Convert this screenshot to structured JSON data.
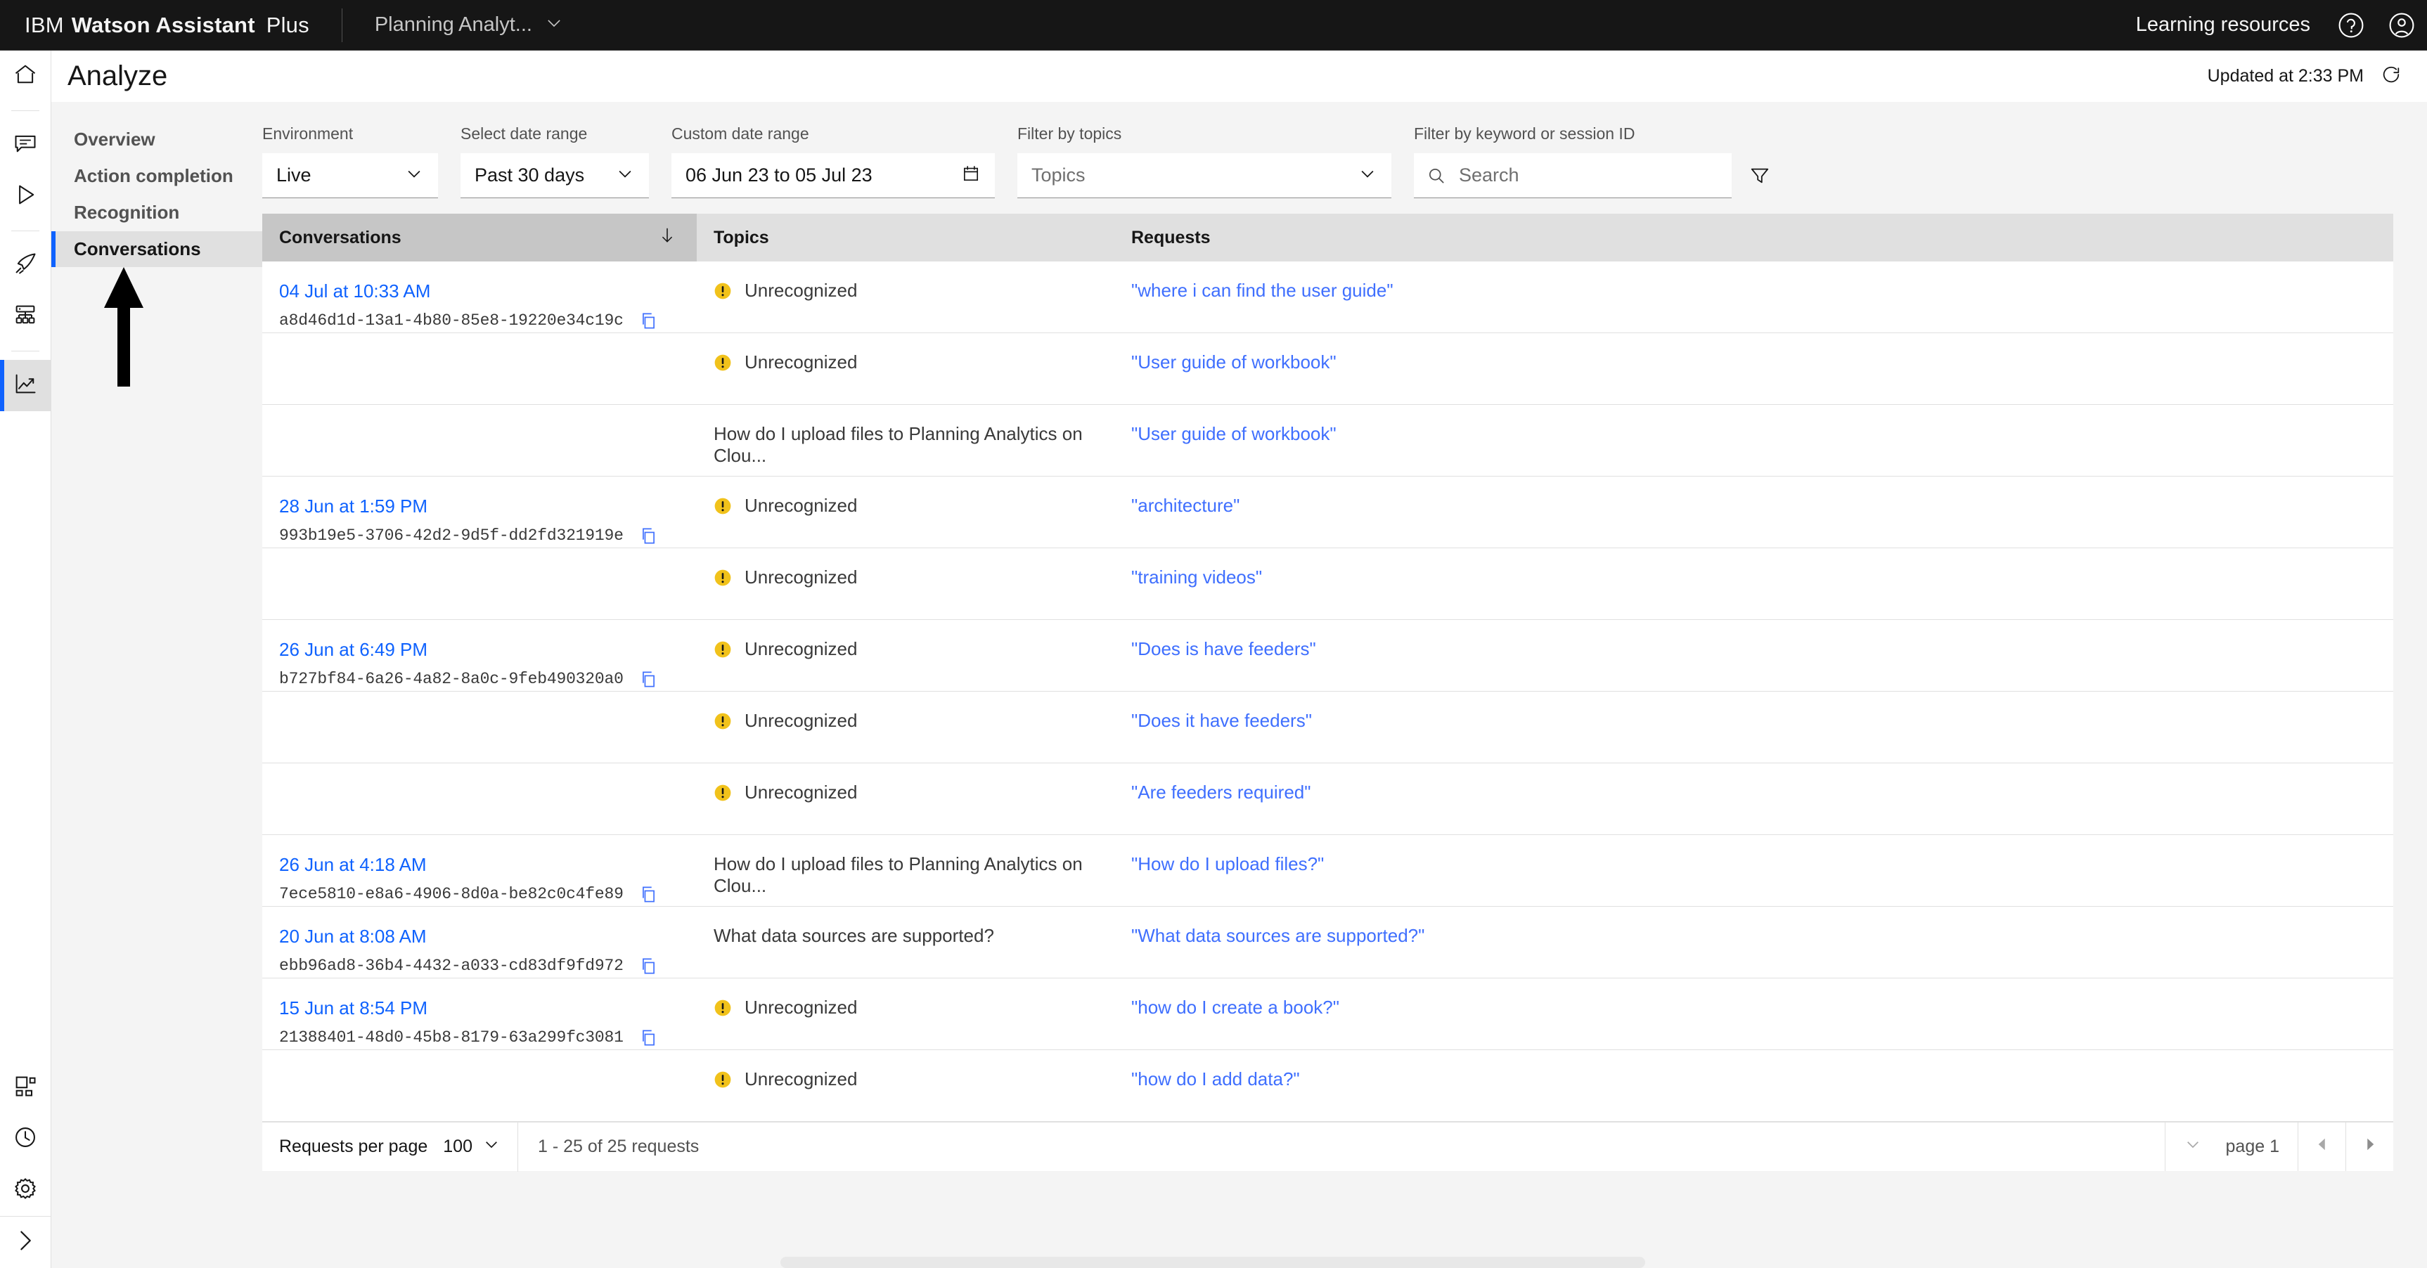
{
  "header": {
    "brand_ibm": "IBM",
    "brand_product": "Watson Assistant",
    "brand_plan": "Plus",
    "assistant_name": "Planning Analyt...",
    "learning_resources": "Learning resources",
    "help_icon": "help-icon",
    "account_icon": "user-avatar-icon",
    "chevron_icon": "chevron-down-icon"
  },
  "rail": {
    "items": [
      {
        "name": "home-icon"
      },
      {
        "name": "chat-icon"
      },
      {
        "name": "preview-play-icon"
      },
      {
        "name": "publish-rocket-icon"
      },
      {
        "name": "integrations-icon"
      },
      {
        "name": "analyze-chart-icon"
      },
      {
        "name": "assistants-icon"
      },
      {
        "name": "activity-clock-icon"
      },
      {
        "name": "settings-gear-icon"
      },
      {
        "name": "expand-rail-icon"
      }
    ]
  },
  "page": {
    "title": "Analyze",
    "updated_text": "Updated at 2:33 PM",
    "refresh_icon": "refresh-icon"
  },
  "leftnav": {
    "items": [
      {
        "label": "Overview",
        "active": false
      },
      {
        "label": "Action completion",
        "active": false
      },
      {
        "label": "Recognition",
        "active": false
      },
      {
        "label": "Conversations",
        "active": true
      }
    ]
  },
  "filters": {
    "environment": {
      "label": "Environment",
      "value": "Live"
    },
    "date_range": {
      "label": "Select date range",
      "value": "Past 30 days"
    },
    "custom_range": {
      "label": "Custom date range",
      "value": "06 Jun 23 to 05 Jul 23",
      "icon": "calendar-icon"
    },
    "topics": {
      "label": "Filter by topics",
      "placeholder": "Topics"
    },
    "keyword": {
      "label": "Filter by keyword or session ID",
      "placeholder": "Search",
      "value": "",
      "icon": "search-icon"
    },
    "filter_button_icon": "filter-funnel-icon"
  },
  "table": {
    "columns": [
      {
        "label": "Conversations",
        "sorted": true,
        "sort_icon": "sort-arrow-down-icon"
      },
      {
        "label": "Topics",
        "sorted": false
      },
      {
        "label": "Requests",
        "sorted": false
      }
    ],
    "rows": [
      {
        "date": "04 Jul at 10:33 AM",
        "session_id": "a8d46d1d-13a1-4b80-85e8-19220e34c19c",
        "topic": "Unrecognized",
        "topic_unrecognized": true,
        "request": "\"where i can find the user guide\""
      },
      {
        "date": "",
        "session_id": "",
        "topic": "Unrecognized",
        "topic_unrecognized": true,
        "request": "\"User guide of workbook\""
      },
      {
        "date": "",
        "session_id": "",
        "topic": "How do I upload files to Planning Analytics on Clou...",
        "topic_unrecognized": false,
        "request": "\"User guide of workbook\""
      },
      {
        "date": "28 Jun at 1:59 PM",
        "session_id": "993b19e5-3706-42d2-9d5f-dd2fd321919e",
        "topic": "Unrecognized",
        "topic_unrecognized": true,
        "request": "\"architecture\""
      },
      {
        "date": "",
        "session_id": "",
        "topic": "Unrecognized",
        "topic_unrecognized": true,
        "request": "\"training videos\""
      },
      {
        "date": "26 Jun at 6:49 PM",
        "session_id": "b727bf84-6a26-4a82-8a0c-9feb490320a0",
        "topic": "Unrecognized",
        "topic_unrecognized": true,
        "request": "\"Does is have feeders\""
      },
      {
        "date": "",
        "session_id": "",
        "topic": "Unrecognized",
        "topic_unrecognized": true,
        "request": "\"Does it have feeders\""
      },
      {
        "date": "",
        "session_id": "",
        "topic": "Unrecognized",
        "topic_unrecognized": true,
        "request": "\"Are feeders required\""
      },
      {
        "date": "26 Jun at 4:18 AM",
        "session_id": "7ece5810-e8a6-4906-8d0a-be82c0c4fe89",
        "topic": "How do I upload files to Planning Analytics on Clou...",
        "topic_unrecognized": false,
        "request": "\"How do I upload files?\""
      },
      {
        "date": "20 Jun at 8:08 AM",
        "session_id": "ebb96ad8-36b4-4432-a033-cd83df9fd972",
        "topic": "What data sources are supported?",
        "topic_unrecognized": false,
        "request": "\"What data sources are supported?\""
      },
      {
        "date": "15 Jun at 8:54 PM",
        "session_id": "21388401-48d0-45b8-8179-63a299fc3081",
        "topic": "Unrecognized",
        "topic_unrecognized": true,
        "request": "\"how do I create a book?\""
      },
      {
        "date": "",
        "session_id": "",
        "topic": "Unrecognized",
        "topic_unrecognized": true,
        "request": "\"how do I add data?\""
      }
    ],
    "copy_icon": "copy-icon"
  },
  "pagination": {
    "per_page_label": "Requests per page",
    "per_page_value": "100",
    "range_text": "1 - 25 of 25 requests",
    "page_label": "page 1",
    "prev_icon": "caret-left-icon",
    "next_icon": "caret-right-icon",
    "chevron_icon": "chevron-down-icon"
  },
  "colors": {
    "accent": "#0f62fe",
    "link": "#3f6ffe",
    "warning": "#f1c21b",
    "header_bg": "#161616"
  }
}
